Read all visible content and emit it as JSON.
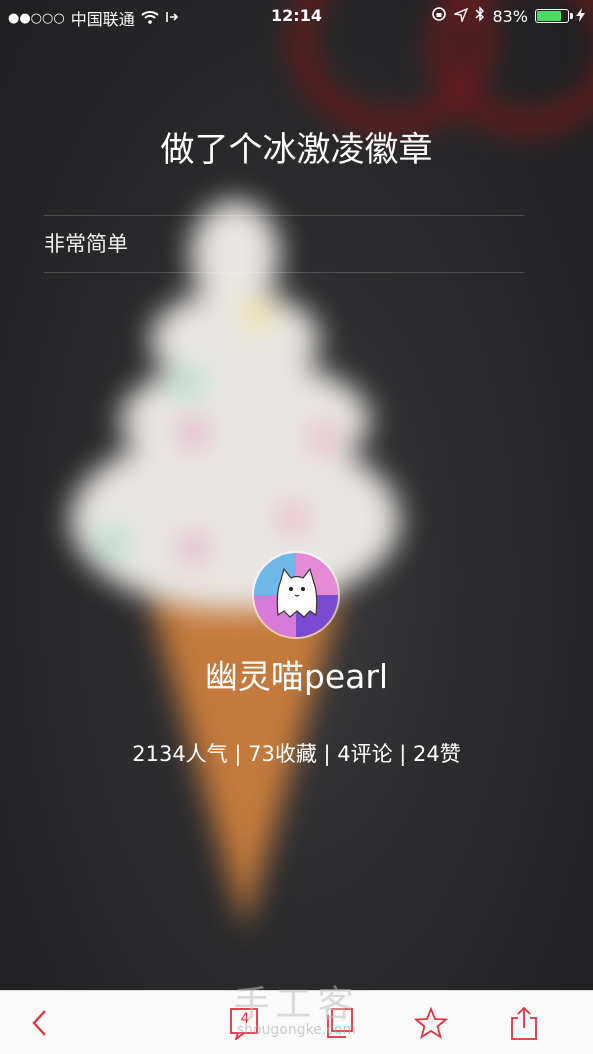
{
  "status_bar": {
    "signal": "●●○○○",
    "carrier": "中国联通",
    "time": "12:14",
    "battery_percent": "83%",
    "battery_level": 0.83
  },
  "post": {
    "title": "做了个冰激凌徽章",
    "description": "非常简单"
  },
  "author": {
    "name": "幽灵喵pearl"
  },
  "stats_text": "2134人气 | 73收藏 | 4评论 | 24赞",
  "toolbar": {
    "comment_count": "4",
    "icons": [
      "back-icon",
      "comment-icon",
      "copy-icon",
      "star-icon",
      "share-icon"
    ],
    "accent_color": "#e0343f"
  },
  "watermark": {
    "text": "手工客",
    "url": "shougongke.com"
  }
}
